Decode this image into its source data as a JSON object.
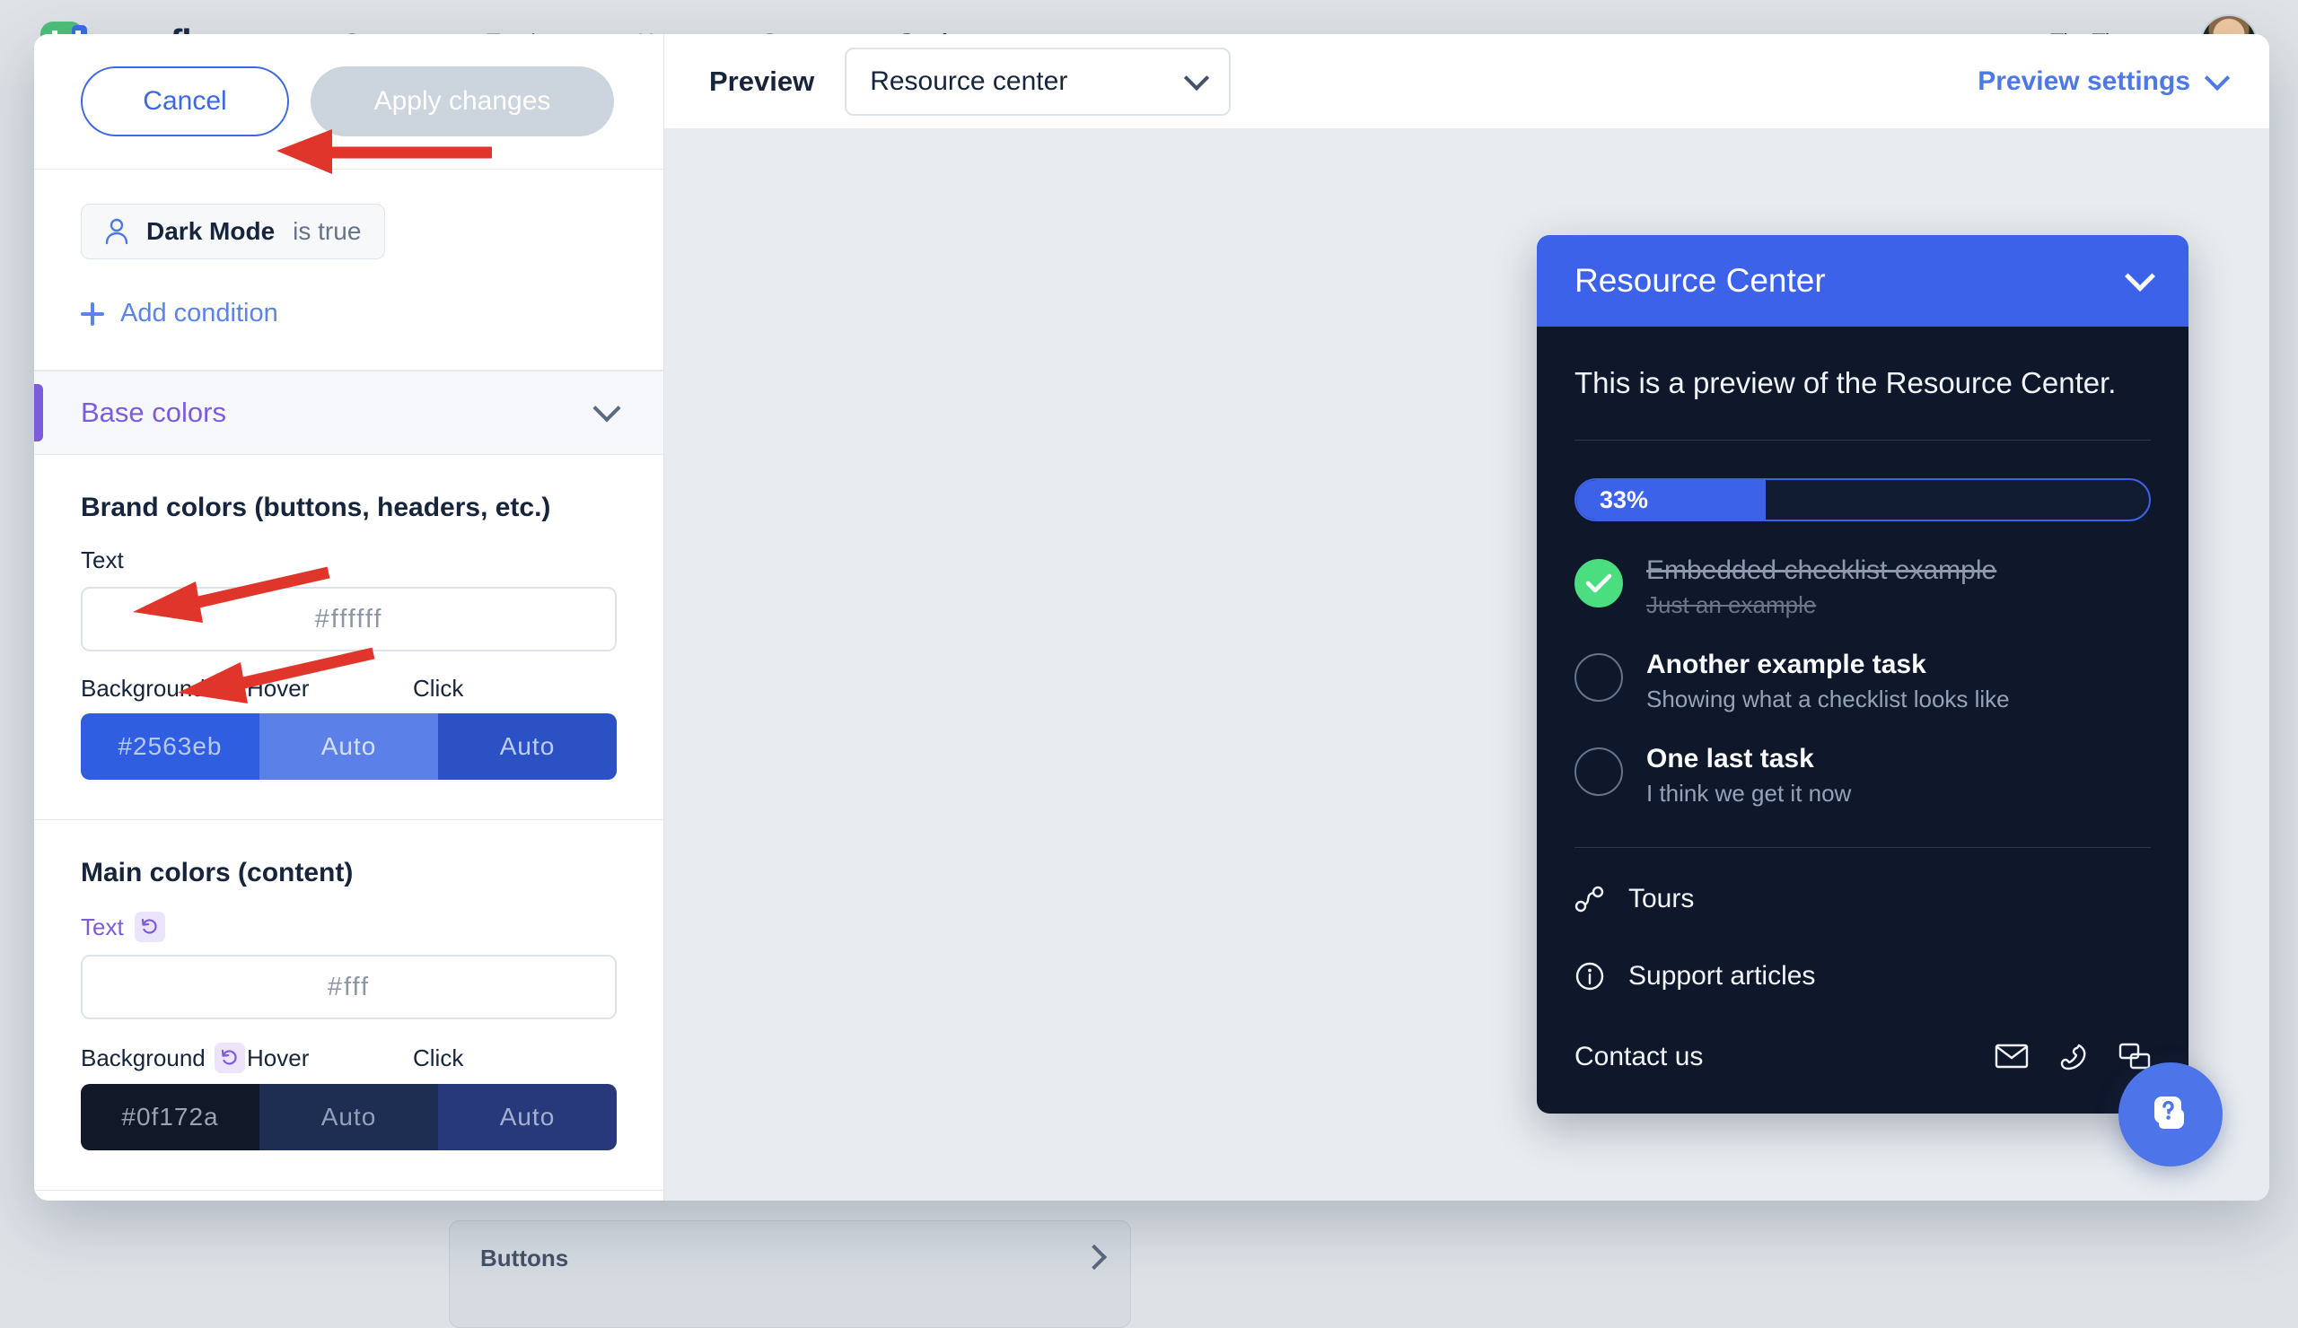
{
  "topnav": {
    "brand": "userflow",
    "links": [
      {
        "label": "Content",
        "active": false
      },
      {
        "label": "Trackers",
        "active": false
      },
      {
        "label": "Users",
        "active": false
      },
      {
        "label": "Groups",
        "active": false
      },
      {
        "label": "Settings",
        "active": true
      }
    ],
    "org": "TinyTime"
  },
  "background": {
    "section_title": "Buttons"
  },
  "editor": {
    "cancel_label": "Cancel",
    "apply_label": "Apply changes",
    "condition": {
      "property": "Dark Mode",
      "operator": "is true",
      "icon": "user-icon"
    },
    "add_condition_label": "Add condition",
    "base_colors": {
      "section_label": "Base colors",
      "brand": {
        "title": "Brand colors (buttons, headers, etc.)",
        "text_label": "Text",
        "text_value": "#ffffff",
        "background_label": "Background",
        "hover_label": "Hover",
        "click_label": "Click",
        "background_value": "#2563eb",
        "hover_value": "Auto",
        "click_value": "Auto",
        "background_swatch": "#2f5fe0",
        "hover_swatch": "#5b80e8",
        "click_swatch": "#2c51c4"
      },
      "main": {
        "title": "Main colors (content)",
        "text_label": "Text",
        "text_value": "#fff",
        "text_reset": true,
        "background_label": "Background",
        "background_reset": true,
        "hover_label": "Hover",
        "click_label": "Click",
        "background_value": "#0f172a",
        "hover_value": "Auto",
        "click_value": "Auto",
        "background_swatch": "#111827",
        "hover_swatch": "#1e2d52",
        "click_swatch": "#27397a"
      }
    }
  },
  "preview": {
    "label": "Preview",
    "selected": "Resource center",
    "settings_label": "Preview settings"
  },
  "resource_center": {
    "title": "Resource Center",
    "intro": "This is a preview of the Resource Center.",
    "progress_percent": "33%",
    "progress_value": 33,
    "tasks": [
      {
        "title": "Embedded checklist example",
        "subtitle": "Just an example",
        "done": true
      },
      {
        "title": "Another example task",
        "subtitle": "Showing what a checklist looks like",
        "done": false
      },
      {
        "title": "One last task",
        "subtitle": "I think we get it now",
        "done": false
      }
    ],
    "links": [
      {
        "label": "Tours",
        "icon": "route-icon"
      },
      {
        "label": "Support articles",
        "icon": "info-icon"
      }
    ],
    "contact_label": "Contact us",
    "contact_icons": [
      "mail-icon",
      "phone-icon",
      "chat-icon"
    ],
    "header_color": "#3b62e8",
    "body_color": "#0f172a"
  },
  "launcher": {
    "icon": "help-question-icon",
    "color": "#4d74e8"
  },
  "annotations": {
    "color": "#e0352b",
    "arrows": [
      {
        "target": "condition-chip"
      },
      {
        "target": "main-text-reset"
      },
      {
        "target": "main-background-reset"
      }
    ]
  }
}
